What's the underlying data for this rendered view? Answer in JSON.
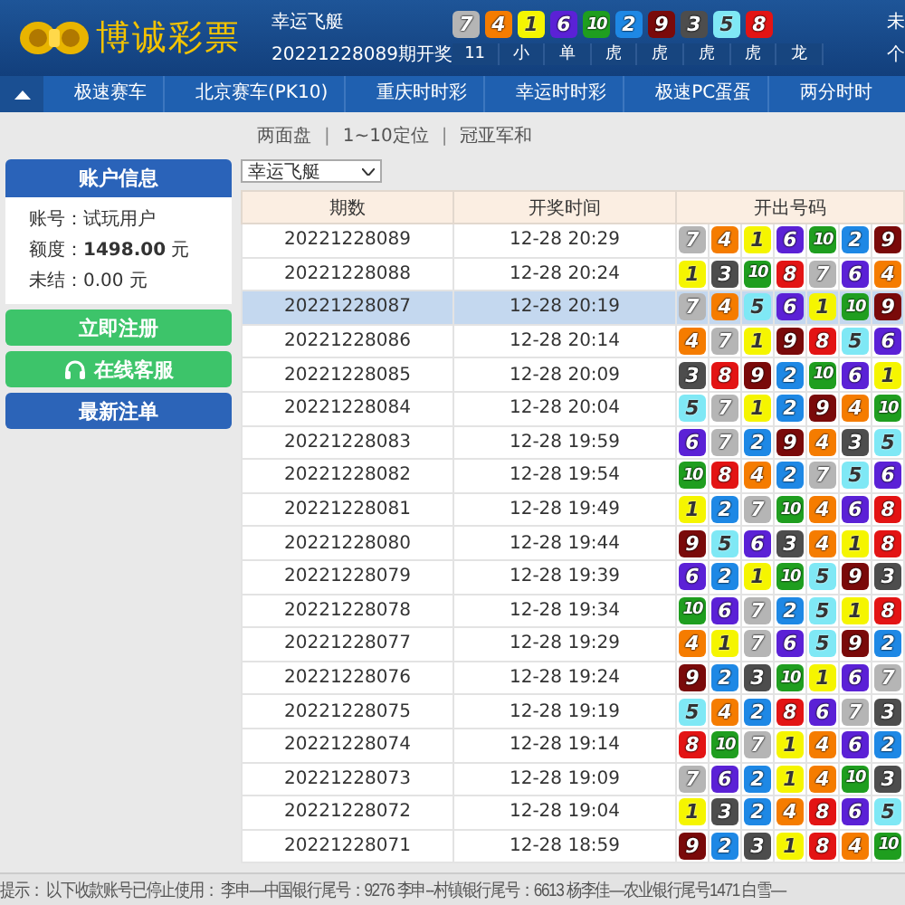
{
  "header": {
    "logo": "博诚彩票",
    "game": "幸运飞艇",
    "issue": "20221228089期开奖",
    "balls": [
      {
        "n": "7",
        "color": "#b5b5b5"
      },
      {
        "n": "4",
        "color": "#f57c00"
      },
      {
        "n": "1",
        "color": "#f5f500"
      },
      {
        "n": "6",
        "color": "#5b21d6"
      },
      {
        "n": "10",
        "color": "#1f9e1f"
      },
      {
        "n": "2",
        "color": "#1e88e5"
      },
      {
        "n": "9",
        "color": "#7a0a0a"
      },
      {
        "n": "3",
        "color": "#4d4d4d"
      },
      {
        "n": "5",
        "color": "#7fe8f5"
      },
      {
        "n": "8",
        "color": "#e31414"
      }
    ],
    "stats": [
      "11",
      "小",
      "单",
      "虎",
      "虎",
      "虎",
      "虎",
      "龙"
    ],
    "user_lines": [
      "未",
      "个"
    ]
  },
  "nav": [
    "极速赛车",
    "北京赛车(PK10)",
    "重庆时时彩",
    "幸运时时彩",
    "极速PC蛋蛋",
    "两分时时"
  ],
  "subnav": [
    {
      "kind": "link",
      "text": "两面盘"
    },
    {
      "kind": "sep",
      "text": "|"
    },
    {
      "kind": "link",
      "text": "1~10定位"
    },
    {
      "kind": "sep",
      "text": "|"
    },
    {
      "kind": "link",
      "text": "冠亚军和"
    }
  ],
  "sidebar": {
    "title": "账户信息",
    "fields": [
      {
        "label": "账号：",
        "value": "试玩用户"
      },
      {
        "label": "额度：",
        "value": "**1498.00** 元"
      },
      {
        "label": "未结：",
        "value": "0.00 元"
      }
    ],
    "buttons": [
      {
        "kind": "register",
        "label": "立即注册"
      },
      {
        "kind": "service",
        "label": "在线客服"
      },
      {
        "kind": "orders",
        "label": "最新注单"
      }
    ]
  },
  "game_select": {
    "value": "幸运飞艇"
  },
  "table": {
    "columns": [
      "期数",
      "开奖时间",
      "开出号码"
    ],
    "rows": [
      {
        "issue": "20221228089",
        "time": "12-28 20:29",
        "selected": false,
        "balls": [
          {
            "n": "7",
            "color": "#b5b5b5"
          },
          {
            "n": "4",
            "color": "#f57c00"
          },
          {
            "n": "1",
            "color": "#f5f500"
          },
          {
            "n": "6",
            "color": "#5b21d6"
          },
          {
            "n": "10",
            "color": "#1f9e1f"
          },
          {
            "n": "2",
            "color": "#1e88e5"
          },
          {
            "n": "9",
            "color": "#7a0a0a"
          }
        ]
      },
      {
        "issue": "20221228088",
        "time": "12-28 20:24",
        "selected": false,
        "balls": [
          {
            "n": "1",
            "color": "#f5f500"
          },
          {
            "n": "3",
            "color": "#4d4d4d"
          },
          {
            "n": "10",
            "color": "#1f9e1f"
          },
          {
            "n": "8",
            "color": "#e31414"
          },
          {
            "n": "7",
            "color": "#b5b5b5"
          },
          {
            "n": "6",
            "color": "#5b21d6"
          },
          {
            "n": "4",
            "color": "#f57c00"
          }
        ]
      },
      {
        "issue": "20221228087",
        "time": "12-28 20:19",
        "selected": true,
        "balls": [
          {
            "n": "7",
            "color": "#b5b5b5"
          },
          {
            "n": "4",
            "color": "#f57c00"
          },
          {
            "n": "5",
            "color": "#7fe8f5"
          },
          {
            "n": "6",
            "color": "#5b21d6"
          },
          {
            "n": "1",
            "color": "#f5f500"
          },
          {
            "n": "10",
            "color": "#1f9e1f"
          },
          {
            "n": "9",
            "color": "#7a0a0a"
          }
        ]
      },
      {
        "issue": "20221228086",
        "time": "12-28 20:14",
        "selected": false,
        "balls": [
          {
            "n": "4",
            "color": "#f57c00"
          },
          {
            "n": "7",
            "color": "#b5b5b5"
          },
          {
            "n": "1",
            "color": "#f5f500"
          },
          {
            "n": "9",
            "color": "#7a0a0a"
          },
          {
            "n": "8",
            "color": "#e31414"
          },
          {
            "n": "5",
            "color": "#7fe8f5"
          },
          {
            "n": "6",
            "color": "#5b21d6"
          }
        ]
      },
      {
        "issue": "20221228085",
        "time": "12-28 20:09",
        "selected": false,
        "balls": [
          {
            "n": "3",
            "color": "#4d4d4d"
          },
          {
            "n": "8",
            "color": "#e31414"
          },
          {
            "n": "9",
            "color": "#7a0a0a"
          },
          {
            "n": "2",
            "color": "#1e88e5"
          },
          {
            "n": "10",
            "color": "#1f9e1f"
          },
          {
            "n": "6",
            "color": "#5b21d6"
          },
          {
            "n": "1",
            "color": "#f5f500"
          }
        ]
      },
      {
        "issue": "20221228084",
        "time": "12-28 20:04",
        "selected": false,
        "balls": [
          {
            "n": "5",
            "color": "#7fe8f5"
          },
          {
            "n": "7",
            "color": "#b5b5b5"
          },
          {
            "n": "1",
            "color": "#f5f500"
          },
          {
            "n": "2",
            "color": "#1e88e5"
          },
          {
            "n": "9",
            "color": "#7a0a0a"
          },
          {
            "n": "4",
            "color": "#f57c00"
          },
          {
            "n": "10",
            "color": "#1f9e1f"
          }
        ]
      },
      {
        "issue": "20221228083",
        "time": "12-28 19:59",
        "selected": false,
        "balls": [
          {
            "n": "6",
            "color": "#5b21d6"
          },
          {
            "n": "7",
            "color": "#b5b5b5"
          },
          {
            "n": "2",
            "color": "#1e88e5"
          },
          {
            "n": "9",
            "color": "#7a0a0a"
          },
          {
            "n": "4",
            "color": "#f57c00"
          },
          {
            "n": "3",
            "color": "#4d4d4d"
          },
          {
            "n": "5",
            "color": "#7fe8f5"
          }
        ]
      },
      {
        "issue": "20221228082",
        "time": "12-28 19:54",
        "selected": false,
        "balls": [
          {
            "n": "10",
            "color": "#1f9e1f"
          },
          {
            "n": "8",
            "color": "#e31414"
          },
          {
            "n": "4",
            "color": "#f57c00"
          },
          {
            "n": "2",
            "color": "#1e88e5"
          },
          {
            "n": "7",
            "color": "#b5b5b5"
          },
          {
            "n": "5",
            "color": "#7fe8f5"
          },
          {
            "n": "6",
            "color": "#5b21d6"
          }
        ]
      },
      {
        "issue": "20221228081",
        "time": "12-28 19:49",
        "selected": false,
        "balls": [
          {
            "n": "1",
            "color": "#f5f500"
          },
          {
            "n": "2",
            "color": "#1e88e5"
          },
          {
            "n": "7",
            "color": "#b5b5b5"
          },
          {
            "n": "10",
            "color": "#1f9e1f"
          },
          {
            "n": "4",
            "color": "#f57c00"
          },
          {
            "n": "6",
            "color": "#5b21d6"
          },
          {
            "n": "8",
            "color": "#e31414"
          }
        ]
      },
      {
        "issue": "20221228080",
        "time": "12-28 19:44",
        "selected": false,
        "balls": [
          {
            "n": "9",
            "color": "#7a0a0a"
          },
          {
            "n": "5",
            "color": "#7fe8f5"
          },
          {
            "n": "6",
            "color": "#5b21d6"
          },
          {
            "n": "3",
            "color": "#4d4d4d"
          },
          {
            "n": "4",
            "color": "#f57c00"
          },
          {
            "n": "1",
            "color": "#f5f500"
          },
          {
            "n": "8",
            "color": "#e31414"
          }
        ]
      },
      {
        "issue": "20221228079",
        "time": "12-28 19:39",
        "selected": false,
        "balls": [
          {
            "n": "6",
            "color": "#5b21d6"
          },
          {
            "n": "2",
            "color": "#1e88e5"
          },
          {
            "n": "1",
            "color": "#f5f500"
          },
          {
            "n": "10",
            "color": "#1f9e1f"
          },
          {
            "n": "5",
            "color": "#7fe8f5"
          },
          {
            "n": "9",
            "color": "#7a0a0a"
          },
          {
            "n": "3",
            "color": "#4d4d4d"
          }
        ]
      },
      {
        "issue": "20221228078",
        "time": "12-28 19:34",
        "selected": false,
        "balls": [
          {
            "n": "10",
            "color": "#1f9e1f"
          },
          {
            "n": "6",
            "color": "#5b21d6"
          },
          {
            "n": "7",
            "color": "#b5b5b5"
          },
          {
            "n": "2",
            "color": "#1e88e5"
          },
          {
            "n": "5",
            "color": "#7fe8f5"
          },
          {
            "n": "1",
            "color": "#f5f500"
          },
          {
            "n": "8",
            "color": "#e31414"
          }
        ]
      },
      {
        "issue": "20221228077",
        "time": "12-28 19:29",
        "selected": false,
        "balls": [
          {
            "n": "4",
            "color": "#f57c00"
          },
          {
            "n": "1",
            "color": "#f5f500"
          },
          {
            "n": "7",
            "color": "#b5b5b5"
          },
          {
            "n": "6",
            "color": "#5b21d6"
          },
          {
            "n": "5",
            "color": "#7fe8f5"
          },
          {
            "n": "9",
            "color": "#7a0a0a"
          },
          {
            "n": "2",
            "color": "#1e88e5"
          }
        ]
      },
      {
        "issue": "20221228076",
        "time": "12-28 19:24",
        "selected": false,
        "balls": [
          {
            "n": "9",
            "color": "#7a0a0a"
          },
          {
            "n": "2",
            "color": "#1e88e5"
          },
          {
            "n": "3",
            "color": "#4d4d4d"
          },
          {
            "n": "10",
            "color": "#1f9e1f"
          },
          {
            "n": "1",
            "color": "#f5f500"
          },
          {
            "n": "6",
            "color": "#5b21d6"
          },
          {
            "n": "7",
            "color": "#b5b5b5"
          }
        ]
      },
      {
        "issue": "20221228075",
        "time": "12-28 19:19",
        "selected": false,
        "balls": [
          {
            "n": "5",
            "color": "#7fe8f5"
          },
          {
            "n": "4",
            "color": "#f57c00"
          },
          {
            "n": "2",
            "color": "#1e88e5"
          },
          {
            "n": "8",
            "color": "#e31414"
          },
          {
            "n": "6",
            "color": "#5b21d6"
          },
          {
            "n": "7",
            "color": "#b5b5b5"
          },
          {
            "n": "3",
            "color": "#4d4d4d"
          }
        ]
      },
      {
        "issue": "20221228074",
        "time": "12-28 19:14",
        "selected": false,
        "balls": [
          {
            "n": "8",
            "color": "#e31414"
          },
          {
            "n": "10",
            "color": "#1f9e1f"
          },
          {
            "n": "7",
            "color": "#b5b5b5"
          },
          {
            "n": "1",
            "color": "#f5f500"
          },
          {
            "n": "4",
            "color": "#f57c00"
          },
          {
            "n": "6",
            "color": "#5b21d6"
          },
          {
            "n": "2",
            "color": "#1e88e5"
          }
        ]
      },
      {
        "issue": "20221228073",
        "time": "12-28 19:09",
        "selected": false,
        "balls": [
          {
            "n": "7",
            "color": "#b5b5b5"
          },
          {
            "n": "6",
            "color": "#5b21d6"
          },
          {
            "n": "2",
            "color": "#1e88e5"
          },
          {
            "n": "1",
            "color": "#f5f500"
          },
          {
            "n": "4",
            "color": "#f57c00"
          },
          {
            "n": "10",
            "color": "#1f9e1f"
          },
          {
            "n": "3",
            "color": "#4d4d4d"
          }
        ]
      },
      {
        "issue": "20221228072",
        "time": "12-28 19:04",
        "selected": false,
        "balls": [
          {
            "n": "1",
            "color": "#f5f500"
          },
          {
            "n": "3",
            "color": "#4d4d4d"
          },
          {
            "n": "2",
            "color": "#1e88e5"
          },
          {
            "n": "4",
            "color": "#f57c00"
          },
          {
            "n": "8",
            "color": "#e31414"
          },
          {
            "n": "6",
            "color": "#5b21d6"
          },
          {
            "n": "5",
            "color": "#7fe8f5"
          }
        ]
      },
      {
        "issue": "20221228071",
        "time": "12-28 18:59",
        "selected": false,
        "balls": [
          {
            "n": "9",
            "color": "#7a0a0a"
          },
          {
            "n": "2",
            "color": "#1e88e5"
          },
          {
            "n": "3",
            "color": "#4d4d4d"
          },
          {
            "n": "1",
            "color": "#f5f500"
          },
          {
            "n": "8",
            "color": "#e31414"
          },
          {
            "n": "4",
            "color": "#f57c00"
          },
          {
            "n": "10",
            "color": "#1f9e1f"
          }
        ]
      }
    ]
  },
  "notice": "提示： 以下收款账号已停止使用： 李申—中国银行尾号：9276 李申--村镇银行尾号：6613 杨李佳—农业银行尾号1471 白雪—"
}
